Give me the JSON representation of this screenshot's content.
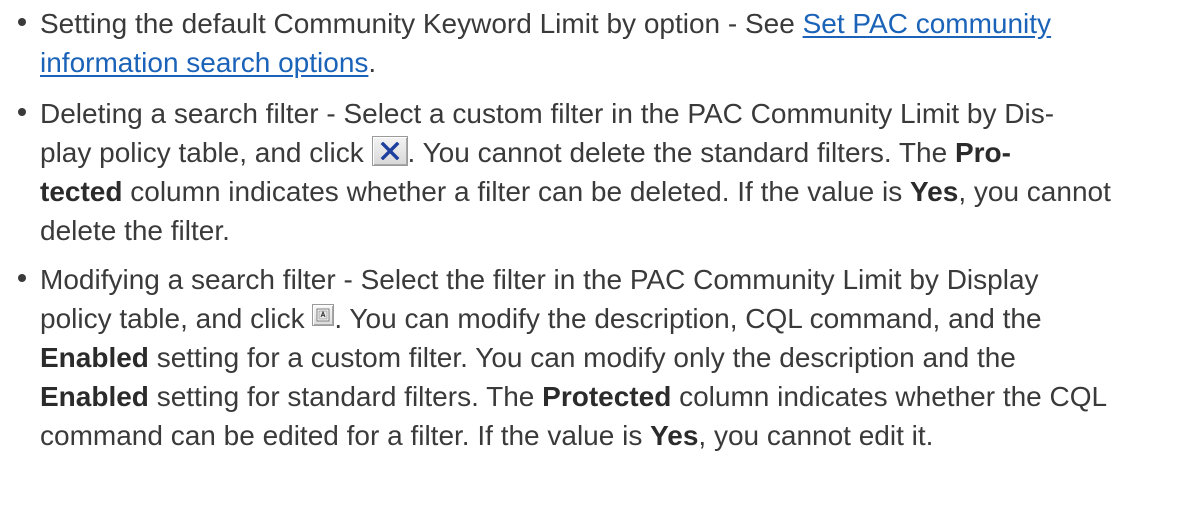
{
  "bullets": [
    {
      "text_before_link": "Setting the default Community Keyword Limit by option - See ",
      "link_text": "Set PAC community information search options",
      "text_after_link": "."
    },
    {
      "line1": "Deleting a search filter - Select a custom filter in the PAC Community Limit by Dis-",
      "line2_before_icon": "play policy table, and click ",
      "icon": "delete-x-icon",
      "after_icon": ". You cannot delete the standard filters. The ",
      "bold_protected": "Pro-",
      "bold_protected_cont": "tected",
      "after_protected": " column indicates whether a filter can be deleted. If the value is ",
      "bold_yes": "Yes",
      "after_yes": ", you cannot delete the filter."
    },
    {
      "line1": "Modifying a search filter - Select the filter in the PAC Community Limit by Display",
      "line2_before_icon": "policy table, and click ",
      "icon": "modify-edit-icon",
      "after_icon": ". You can modify the description, CQL command, and the ",
      "bold_enabled_1": "Enabled",
      "after_enabled_1": " setting for a custom filter. You can modify only the description and the ",
      "bold_enabled_2": "Enabled",
      "after_enabled_2": " setting for standard filters. The ",
      "bold_protected": "Protected",
      "after_protected": " column indicates whether the CQL command can be edited for a filter. If the value is ",
      "bold_yes": "Yes",
      "after_yes": ", you cannot edit it."
    }
  ],
  "colors": {
    "text": "#3a3a3a",
    "link": "#1a63b8",
    "delete_icon": "#1d3f9e"
  }
}
